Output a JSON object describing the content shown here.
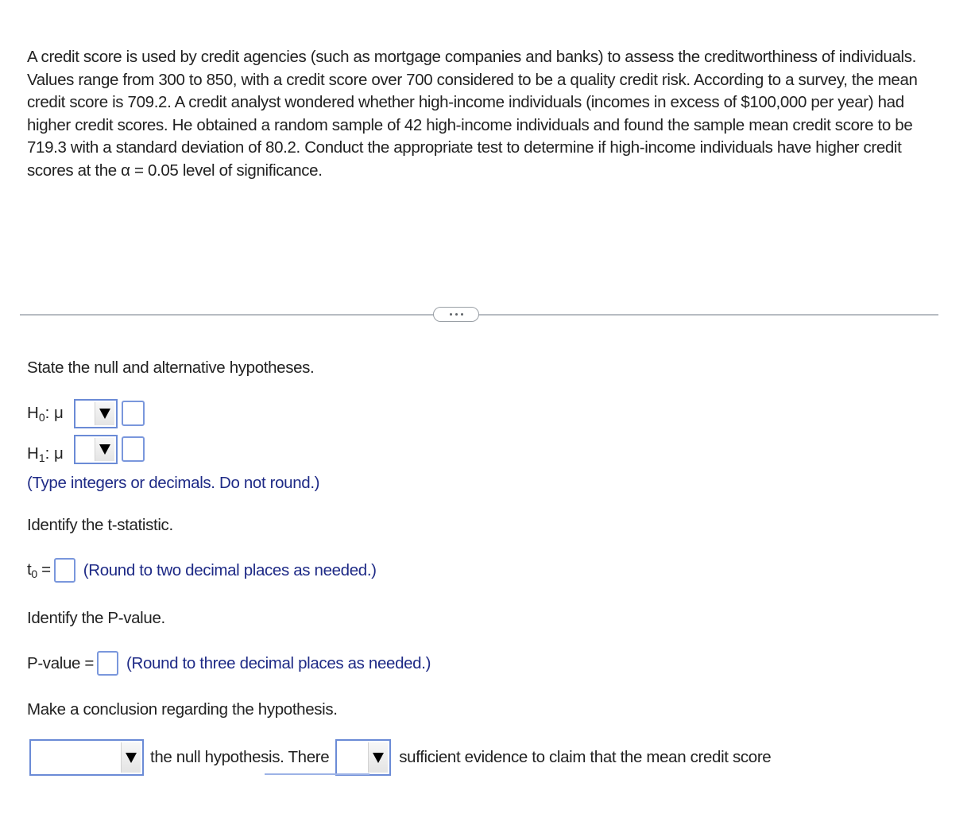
{
  "problem": {
    "text": "A credit score is used by credit agencies (such as mortgage companies and banks) to assess the creditworthiness of individuals. Values range from 300 to 850, with a credit score over 700 considered to be a quality credit risk. According to a survey, the mean credit score is 709.2. A credit analyst wondered whether high-income individuals (incomes in excess of $100,000 per year) had higher credit scores. He obtained a random sample of 42 high-income individuals and found the sample mean credit score to be 719.3 with a standard deviation of 80.2. Conduct the appropriate test to determine if high-income individuals have higher credit scores at the α = 0.05 level of significance."
  },
  "divider": {
    "handle_icon": "more-horizontal-icon"
  },
  "hypotheses": {
    "prompt": "State the null and alternative hypotheses.",
    "h0": {
      "label_main": "H",
      "label_sub": "0",
      "label_rest": ": μ",
      "operator_selected": "",
      "value": ""
    },
    "h1": {
      "label_main": "H",
      "label_sub": "1",
      "label_rest": ": μ",
      "operator_selected": "",
      "value": ""
    },
    "hint": "(Type integers or decimals. Do not round.)"
  },
  "tstat": {
    "prompt": "Identify the t-statistic.",
    "label_main": "t",
    "label_sub": "0",
    "label_eq": " =",
    "value": "",
    "hint": "(Round to two decimal places as needed.)"
  },
  "pvalue": {
    "prompt": "Identify the P-value.",
    "label": "P-value =",
    "value": "",
    "hint": "(Round to three decimal places as needed.)"
  },
  "conclusion": {
    "prompt": "Make a conclusion regarding the hypothesis.",
    "decision_selected": "",
    "text_after_decision": "the null hypothesis. There",
    "evidence_selected": "",
    "text_after_evidence": "sufficient evidence to claim that the mean credit score"
  },
  "colors": {
    "hint_text": "#1e2a86",
    "input_border": "#7a97dc",
    "body_text": "#222222"
  }
}
